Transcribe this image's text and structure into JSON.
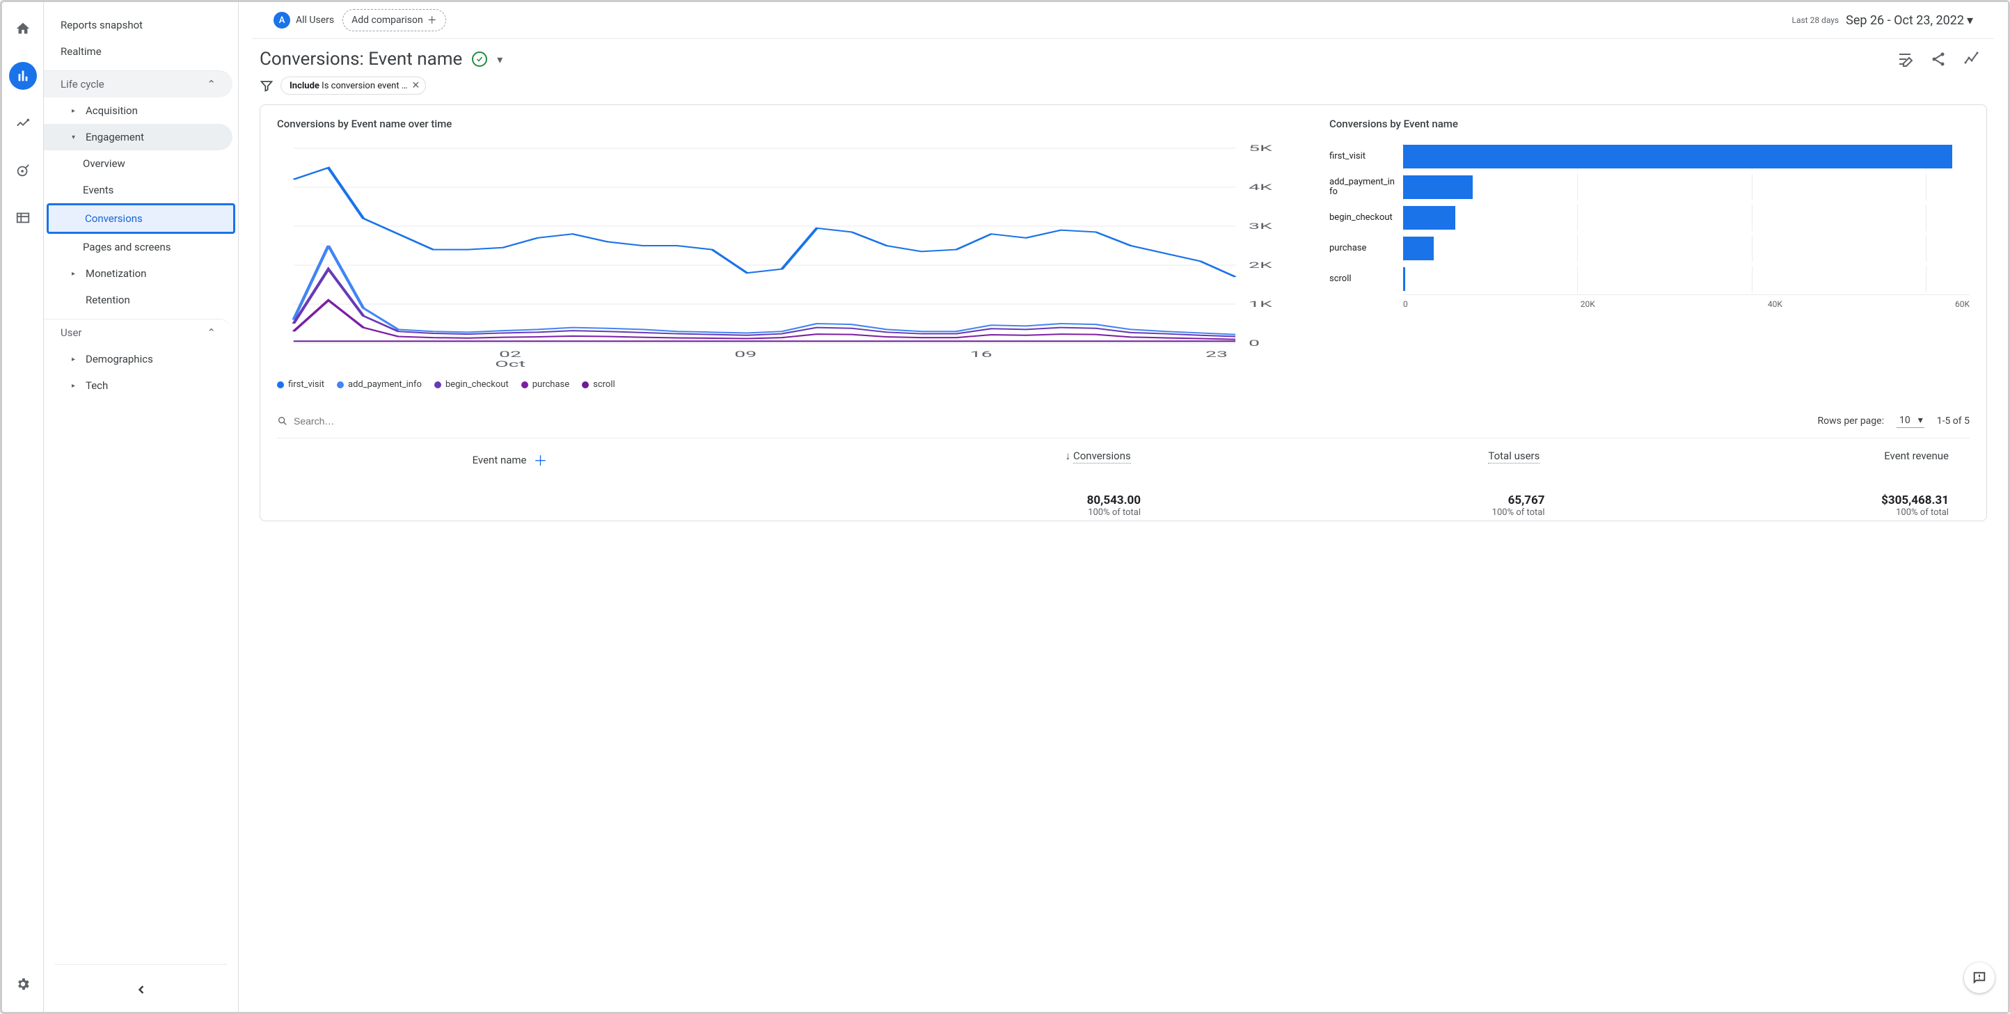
{
  "rail": {
    "active_index": 1
  },
  "sidebar": {
    "top_items": [
      "Reports snapshot",
      "Realtime"
    ],
    "section_lifecycle": "Life cycle",
    "lifecycle_items": {
      "acquisition": "Acquisition",
      "engagement": "Engagement",
      "eng_children": [
        "Overview",
        "Events",
        "Conversions",
        "Pages and screens"
      ],
      "eng_selected_index": 2,
      "monetization": "Monetization",
      "retention": "Retention"
    },
    "section_user": "User",
    "user_items": [
      "Demographics",
      "Tech"
    ]
  },
  "segment": {
    "badge": "A",
    "label": "All Users",
    "add_label": "Add comparison"
  },
  "date": {
    "desc": "Last 28 days",
    "range": "Sep 26 - Oct 23, 2022"
  },
  "title": "Conversions: Event name",
  "filter": {
    "prefix": "Include",
    "text": "Is conversion event …"
  },
  "chart_data": [
    {
      "type": "line",
      "title": "Conversions by Event name over time",
      "x_label_month": "Oct",
      "x_ticks": [
        "02",
        "09",
        "16",
        "23"
      ],
      "y_ticks": [
        "0",
        "1K",
        "2K",
        "3K",
        "4K",
        "5K"
      ],
      "ylim": [
        0,
        5000
      ],
      "colors": {
        "first_visit": "#1a73e8",
        "add_payment_info": "#4285f4",
        "begin_checkout": "#673ab7",
        "purchase": "#7b1fa2",
        "scroll": "#6a1b9a"
      },
      "series": [
        {
          "name": "first_visit",
          "values": [
            4200,
            4500,
            3200,
            2800,
            2400,
            2400,
            2450,
            2700,
            2800,
            2600,
            2500,
            2500,
            2400,
            1800,
            1900,
            2950,
            2850,
            2500,
            2350,
            2400,
            2800,
            2700,
            2900,
            2850,
            2500,
            2300,
            2100,
            1700
          ]
        },
        {
          "name": "add_payment_info",
          "values": [
            600,
            2500,
            900,
            350,
            300,
            280,
            320,
            350,
            400,
            380,
            350,
            300,
            280,
            260,
            300,
            500,
            480,
            350,
            300,
            300,
            460,
            440,
            500,
            480,
            350,
            300,
            260,
            220
          ]
        },
        {
          "name": "begin_checkout",
          "values": [
            500,
            1900,
            700,
            300,
            250,
            230,
            260,
            280,
            320,
            300,
            270,
            240,
            220,
            200,
            240,
            400,
            380,
            280,
            240,
            240,
            370,
            350,
            400,
            380,
            270,
            240,
            200,
            170
          ]
        },
        {
          "name": "purchase",
          "values": [
            300,
            1100,
            400,
            170,
            140,
            130,
            150,
            160,
            180,
            170,
            150,
            135,
            125,
            115,
            140,
            230,
            220,
            160,
            140,
            140,
            215,
            200,
            230,
            220,
            155,
            135,
            115,
            95
          ]
        },
        {
          "name": "scroll",
          "values": [
            50,
            50,
            50,
            50,
            50,
            50,
            50,
            50,
            50,
            50,
            50,
            50,
            50,
            50,
            50,
            50,
            50,
            50,
            50,
            50,
            50,
            50,
            50,
            50,
            50,
            50,
            50,
            50
          ]
        }
      ]
    },
    {
      "type": "bar",
      "orientation": "horizontal",
      "title": "Conversions by Event name",
      "x_ticks": [
        "0",
        "20K",
        "40K",
        "60K"
      ],
      "xlim": [
        0,
        65000
      ],
      "categories": [
        "first_visit",
        "add_payment_info",
        "begin_checkout",
        "purchase",
        "scroll"
      ],
      "values": [
        63000,
        8000,
        6000,
        3500,
        200
      ]
    }
  ],
  "legend": [
    "first_visit",
    "add_payment_info",
    "begin_checkout",
    "purchase",
    "scroll"
  ],
  "table": {
    "search_placeholder": "Search…",
    "rows_label": "Rows per page:",
    "rows_value": "10",
    "range": "1-5 of 5",
    "headers": {
      "event": "Event name",
      "conversions": "Conversions",
      "users": "Total users",
      "revenue": "Event revenue"
    },
    "totals": {
      "conversions": {
        "value": "80,543.00",
        "sub": "100% of total"
      },
      "users": {
        "value": "65,767",
        "sub": "100% of total"
      },
      "revenue": {
        "value": "$305,468.31",
        "sub": "100% of total"
      }
    }
  }
}
